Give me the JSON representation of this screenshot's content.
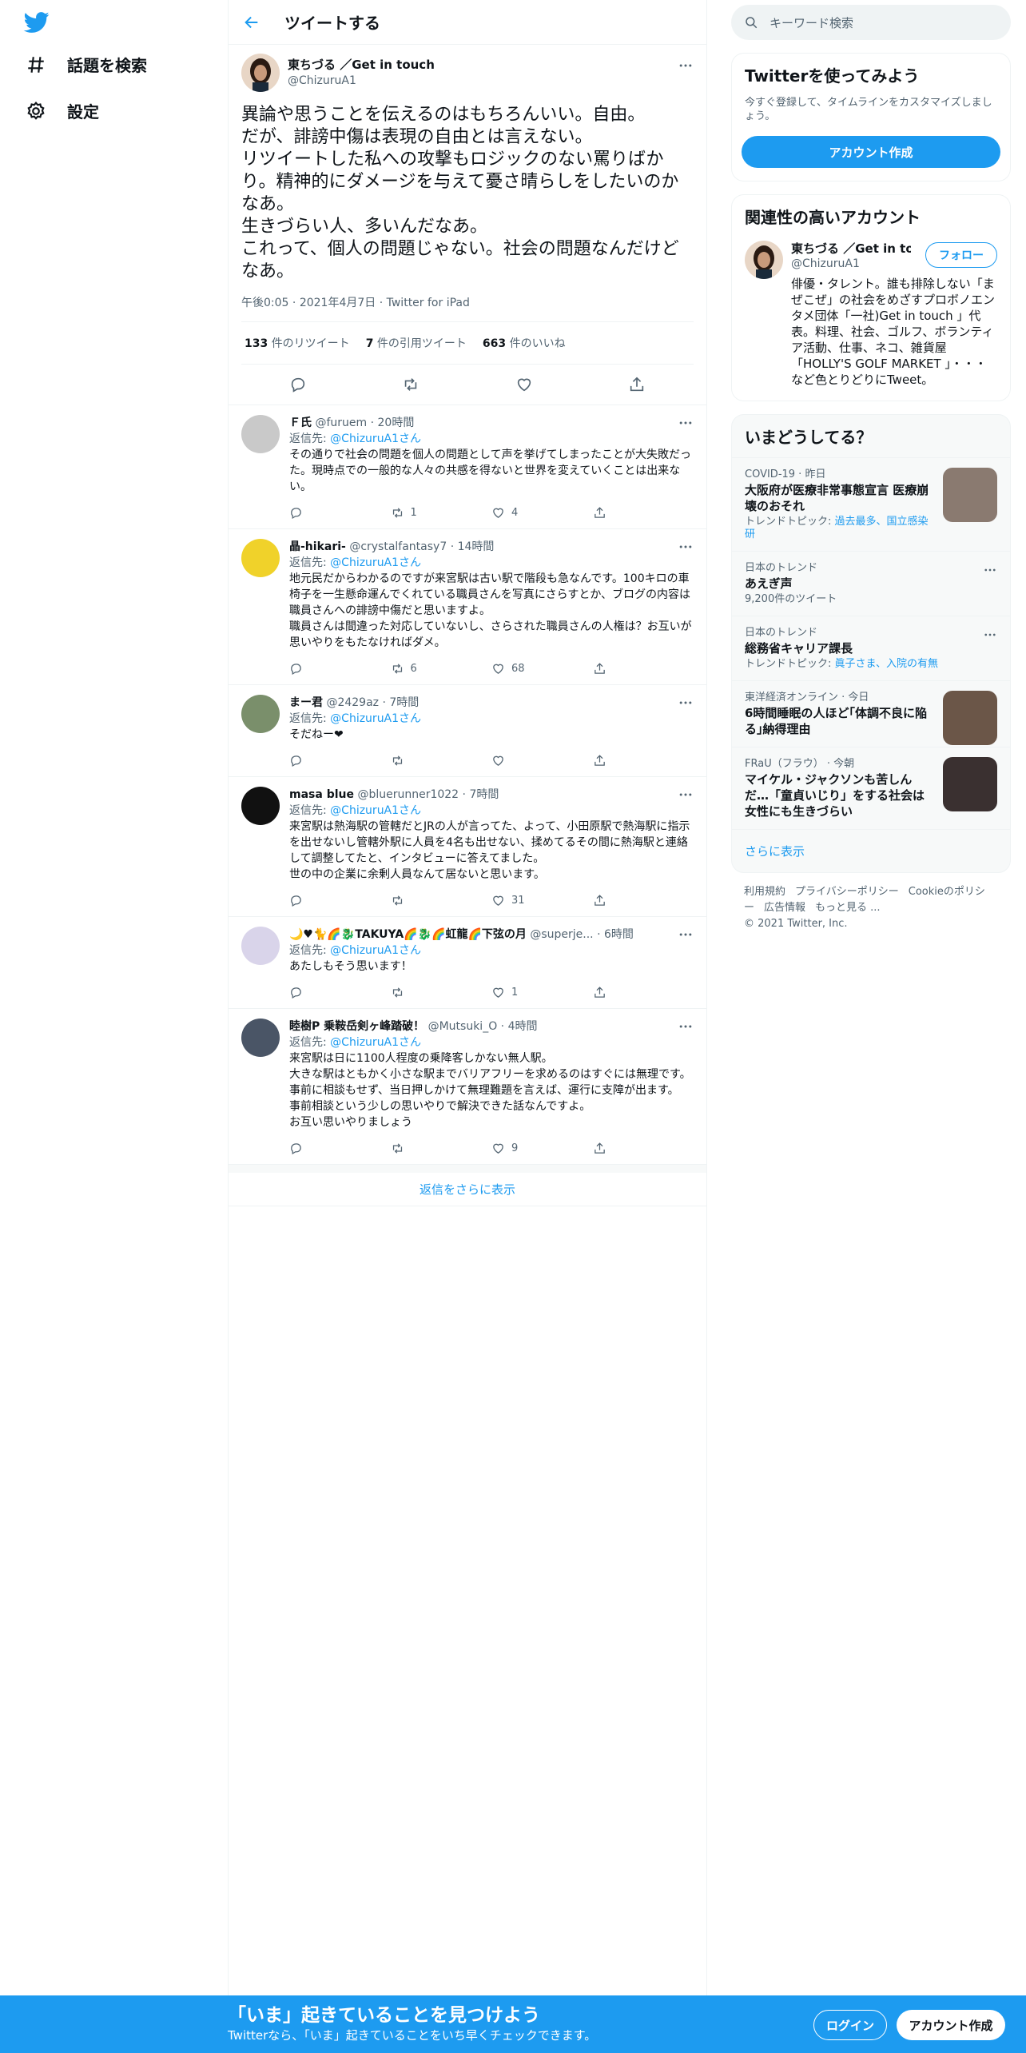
{
  "nav": {
    "items": [
      {
        "label": "話題を検索",
        "icon": "hashtag-icon"
      },
      {
        "label": "設定",
        "icon": "gear-icon"
      }
    ]
  },
  "main": {
    "title": "ツイートする"
  },
  "tweet": {
    "author_name": "東ちづる ／Get in touch",
    "author_handle": "@ChizuruA1",
    "text": "異論や思うことを伝えるのはもちろんいい。自由。\nだが、誹謗中傷は表現の自由とは言えない。\nリツイートした私への攻撃もロジックのない罵りばかり。精神的にダメージを与えて憂さ晴らしをしたいのかなあ。\n生きづらい人、多いんだなあ。\nこれって、個人の問題じゃない。社会の問題なんだけどなあ。",
    "time": "午後0:05",
    "date": "2021年4月7日",
    "source": "Twitter for iPad",
    "retweets": "133",
    "retweets_label": "件のリツイート",
    "quotes": "7",
    "quotes_label": "件の引用ツイート",
    "likes": "663",
    "likes_label": "件のいいね"
  },
  "replies": [
    {
      "name": "Ｆ氏",
      "handle": "@furuem",
      "time": "20時間",
      "reply_to_prefix": "返信先: ",
      "reply_to": "@ChizuruA1さん",
      "text": "その通りで社会の問題を個人の問題として声を挙げてしまったことが大失敗だった。現時点での一般的な人々の共感を得ないと世界を変えていくことは出来ない。",
      "replies": "",
      "retweets": "1",
      "likes": "4"
    },
    {
      "name": "晶-hikari-",
      "handle": "@crystalfantasy7",
      "time": "14時間",
      "reply_to_prefix": "返信先: ",
      "reply_to": "@ChizuruA1さん",
      "text": "地元民だからわかるのですが来宮駅は古い駅で階段も急なんです。100キロの車椅子を一生懸命運んでくれている職員さんを写真にさらすとか、ブログの内容は職員さんへの誹謗中傷だと思いますよ。\n職員さんは間違った対応していないし、さらされた職員さんの人権は？お互いが思いやりをもたなければダメ。",
      "replies": "",
      "retweets": "6",
      "likes": "68"
    },
    {
      "name": "まー君",
      "handle": "@2429az",
      "time": "7時間",
      "reply_to_prefix": "返信先: ",
      "reply_to": "@ChizuruA1さん",
      "text": "そだねー❤",
      "replies": "",
      "retweets": "",
      "likes": ""
    },
    {
      "name": "masa blue",
      "handle": "@bluerunner1022",
      "time": "7時間",
      "reply_to_prefix": "返信先: ",
      "reply_to": "@ChizuruA1さん",
      "text": "来宮駅は熱海駅の管轄だとJRの人が言ってた、よって、小田原駅で熱海駅に指示を出せないし管轄外駅に人員を4名も出せない、揉めてるその間に熱海駅と連絡して調整してたと、インタビューに答えてました。\n世の中の企業に余剰人員なんて居ないと思います。",
      "replies": "",
      "retweets": "",
      "likes": "31"
    },
    {
      "name": "🌙♥🐈🌈🐉TAKUYA🌈🐉🌈虹龍🌈下弦の月",
      "handle": "@superje...",
      "time": "6時間",
      "reply_to_prefix": "返信先: ",
      "reply_to": "@ChizuruA1さん",
      "text": "あたしもそう思います！",
      "replies": "",
      "retweets": "",
      "likes": "1"
    },
    {
      "name": "睦樹P 乗鞍岳剣ヶ峰踏破！",
      "handle": "@Mutsuki_O",
      "time": "4時間",
      "reply_to_prefix": "返信先: ",
      "reply_to": "@ChizuruA1さん",
      "text": "来宮駅は日に1100人程度の乗降客しかない無人駅。\n大きな駅はともかく小さな駅までバリアフリーを求めるのはすぐには無理です。\n事前に相談もせず、当日押しかけて無理難題を言えば、運行に支障が出ます。\n事前相談という少しの思いやりで解決できた話なんですよ。\nお互い思いやりましょう",
      "replies": "",
      "retweets": "",
      "likes": "9"
    }
  ],
  "show_more_replies": "返信をさらに表示",
  "search": {
    "placeholder": "キーワード検索"
  },
  "signup_card": {
    "title": "Twitterを使ってみよう",
    "subtitle": "今すぐ登録して、タイムラインをカスタマイズしましょう。",
    "button": "アカウント作成"
  },
  "related": {
    "title": "関連性の高いアカウント",
    "name": "東ちづる ／Get in to...",
    "handle": "@ChizuruA1",
    "bio": "俳優・タレント。誰も排除しない「まぜこぜ」の社会をめざすプロボノエンタメ団体「一社)Get in touch 」代表。料理、社会、ゴルフ、ボランティア活動、仕事、ネコ、雑貨屋「HOLLY'S GOLF MARKET 」・・・など色とりどりにTweet。",
    "follow": "フォロー"
  },
  "trends": {
    "title": "いまどうしてる？",
    "items": [
      {
        "category": "COVID-19 · 昨日",
        "title": "大阪府が医療非常事態宣言 医療崩壊のおそれ",
        "sub_prefix": "トレンドトピック: ",
        "sub_links": "過去最多、国立感染研",
        "thumb": true
      },
      {
        "category": "日本のトレンド",
        "title": "あえぎ声",
        "sub_prefix": "9,200件のツイート",
        "sub_links": "",
        "thumb": false
      },
      {
        "category": "日本のトレンド",
        "title": "総務省キャリア課長",
        "sub_prefix": "トレンドトピック: ",
        "sub_links": "眞子さま、入院の有無",
        "thumb": false
      },
      {
        "category": "東洋経済オンライン · 今日",
        "title": "6時間睡眠の人ほど｢体調不良に陥る｣納得理由",
        "sub_prefix": "",
        "sub_links": "",
        "thumb": true
      },
      {
        "category": "FRaU（フラウ） · 今朝",
        "title": "マイケル・ジャクソンも苦しんだ…「童貞いじり」をする社会は女性にも生きづらい",
        "sub_prefix": "",
        "sub_links": "",
        "thumb": true
      }
    ],
    "show_more": "さらに表示"
  },
  "footer": {
    "links": [
      "利用規約",
      "プライバシーポリシー",
      "Cookieのポリシー",
      "広告情報",
      "もっと見る ..."
    ],
    "copyright": "© 2021 Twitter, Inc."
  },
  "bottom_bar": {
    "title": "「いま」起きていることを見つけよう",
    "subtitle": "Twitterなら、「いま」起きていることをいち早くチェックできます。",
    "login": "ログイン",
    "signup": "アカウント作成"
  },
  "colors": {
    "accent": "#1d9bf0",
    "text": "#0f1419",
    "secondary": "#536471"
  }
}
